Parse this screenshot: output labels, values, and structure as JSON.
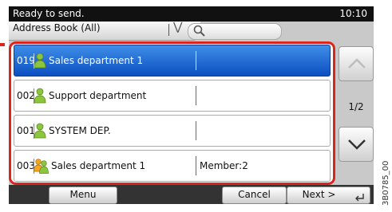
{
  "status": {
    "text": "Ready to send.",
    "time": "10:10"
  },
  "address_book": {
    "selected": "Address Book (All)"
  },
  "list": {
    "rows": [
      {
        "number": "019",
        "name": "Sales department 1",
        "member": "",
        "selected": true,
        "icon": "single-user-icon"
      },
      {
        "number": "002",
        "name": "Support department",
        "member": "",
        "selected": false,
        "icon": "single-user-icon"
      },
      {
        "number": "001",
        "name": "SYSTEM DEP.",
        "member": "",
        "selected": false,
        "icon": "single-user-icon"
      },
      {
        "number": "003",
        "name": "Sales department 1",
        "member": "Member:2",
        "selected": false,
        "icon": "group-users-icon"
      }
    ]
  },
  "pagination": {
    "page": "1/2"
  },
  "buttons": {
    "menu": "Menu",
    "cancel": "Cancel",
    "next": "Next >"
  },
  "doc_id": "3B0785_00",
  "colors": {
    "highlight": "#d8261c",
    "selected_row": "#1a5fd0",
    "status_bar": "#111111"
  }
}
